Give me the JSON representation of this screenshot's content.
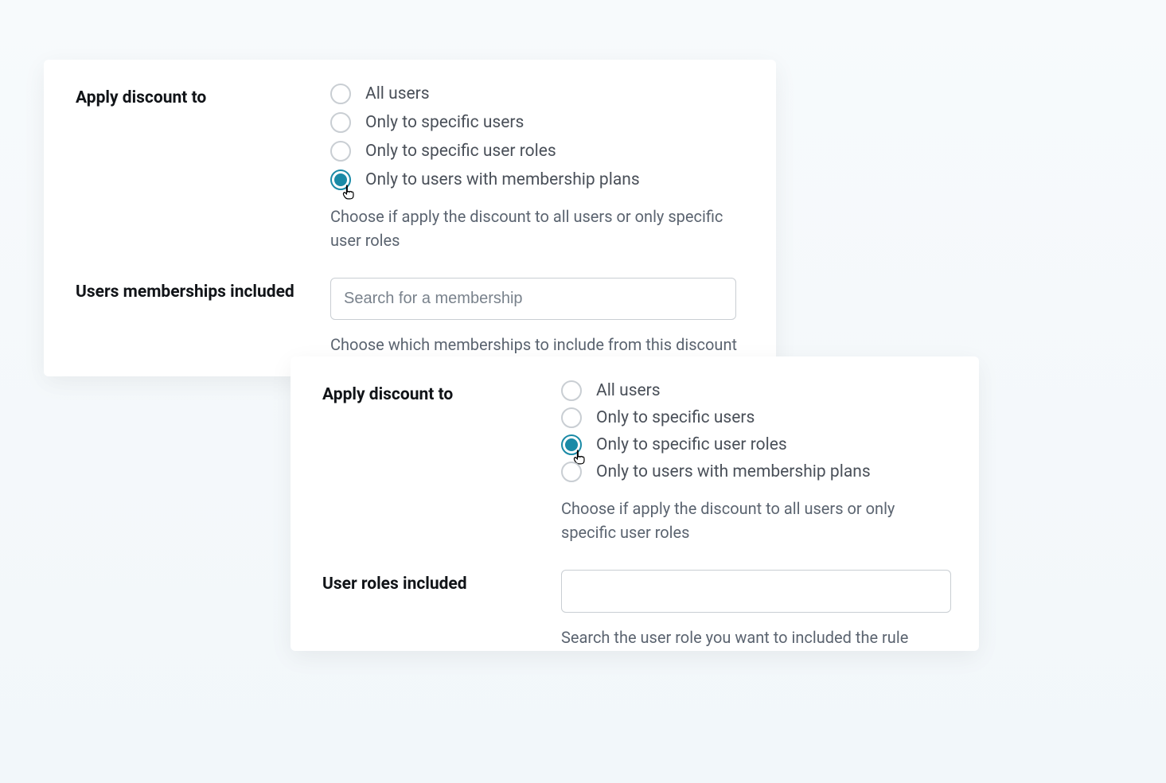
{
  "panel1": {
    "apply_label": "Apply discount to",
    "options": [
      "All users",
      "Only to specific users",
      "Only to specific user roles",
      "Only to users with membership plans"
    ],
    "selected_index": 3,
    "apply_help": "Choose if apply the discount to all users or only specific user roles",
    "memberships_label": "Users memberships included",
    "memberships_placeholder": "Search for a membership",
    "memberships_help": "Choose which memberships to include from this discount"
  },
  "panel2": {
    "apply_label": "Apply discount to",
    "options": [
      "All users",
      "Only to specific users",
      "Only to specific user roles",
      "Only to users with membership plans"
    ],
    "selected_index": 2,
    "apply_help": "Choose if apply the discount to all users or only specific user roles",
    "roles_label": "User roles included",
    "roles_help": "Search the user role you want to included the rule"
  }
}
